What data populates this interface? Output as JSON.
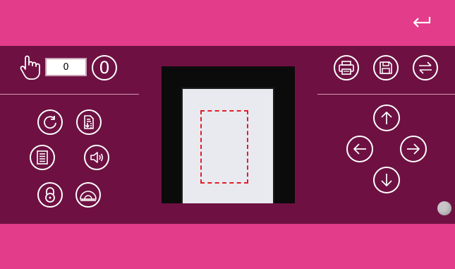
{
  "counter": {
    "value": "0"
  },
  "zero_button": {
    "label": "0"
  },
  "icons": {
    "back": "back-arrow-icon",
    "hand": "hand-pointer-icon",
    "rotate": "rotate-icon",
    "document_import": "document-import-icon",
    "list": "list-icon",
    "sound": "speaker-icon",
    "lock": "lock-icon",
    "ruler": "protractor-icon",
    "print": "print-icon",
    "save": "save-icon",
    "swap": "swap-icon",
    "up": "arrow-up-icon",
    "down": "arrow-down-icon",
    "left": "arrow-left-icon",
    "right": "arrow-right-icon"
  },
  "colors": {
    "top_bar": "#e23c8a",
    "panel": "#6e1142",
    "crop_border": "#e01e2a"
  }
}
